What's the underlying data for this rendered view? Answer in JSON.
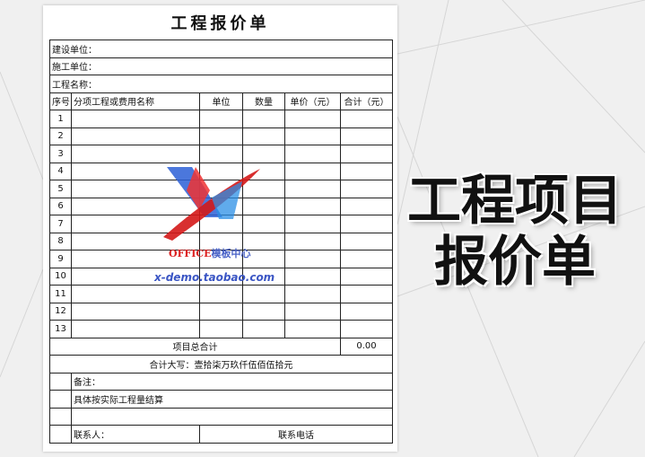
{
  "document": {
    "title": "工程报价单",
    "fields": {
      "builder": "建设单位：",
      "constructor": "施工单位：",
      "project_name": "工程名称："
    },
    "table": {
      "headers": [
        "序号",
        "分项工程或费用名称",
        "单位",
        "数量",
        "单价（元）",
        "合计（元）"
      ],
      "row_numbers": [
        "1",
        "2",
        "3",
        "4",
        "5",
        "6",
        "7",
        "8",
        "9",
        "10",
        "11",
        "12",
        "13"
      ]
    },
    "total_label": "项目总合计",
    "total_value": "0.00",
    "amount_in_words": "合计大写：壹拾柒万玖仟伍佰伍拾元",
    "remarks_label": "备注：",
    "remarks_text": "具体按实际工程量结算",
    "contact_label": "联系人：",
    "phone_label": "联系电话"
  },
  "watermark": {
    "office": "OFFICE",
    "center": "模板中心",
    "url": "x-demo.taobao.com",
    "colors": {
      "red": "#dd2222",
      "blue": "#3a55c4"
    }
  },
  "side_title": {
    "line1": "工程项目",
    "line2": "报价单"
  }
}
